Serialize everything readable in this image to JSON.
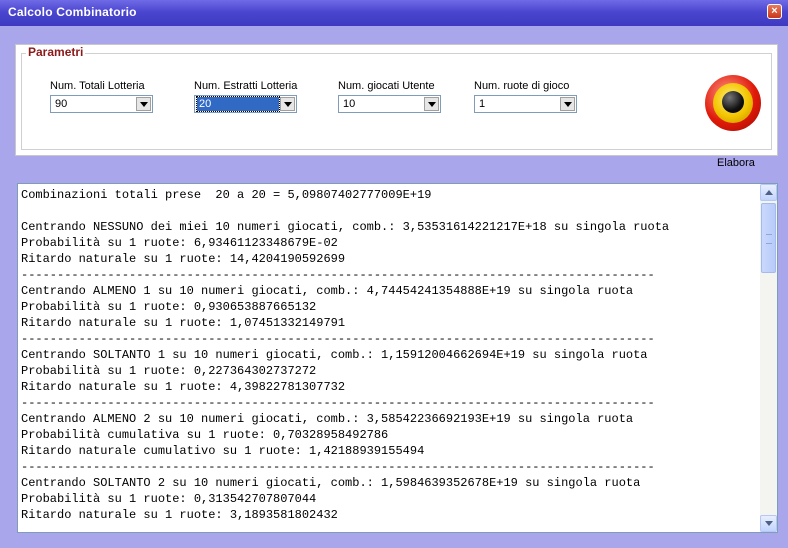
{
  "window": {
    "title": "Calcolo Combinatorio",
    "close_glyph": "×"
  },
  "params": {
    "legend": "Parametri",
    "fields": [
      {
        "label": "Num. Totali Lotteria",
        "value": "90"
      },
      {
        "label": "Num. Estratti Lotteria",
        "value": "20"
      },
      {
        "label": "Num. giocati Utente",
        "value": "10"
      },
      {
        "label": "Num. ruote di gioco",
        "value": "1"
      }
    ],
    "action": {
      "label": "Elabora",
      "icon": "record-button-icon"
    }
  },
  "output": {
    "lines": [
      "Combinazioni totali prese  20 a 20 = 5,09807402777009E+19",
      "",
      "Centrando NESSUNO dei miei 10 numeri giocati, comb.: 3,53531614221217E+18 su singola ruota",
      "Probabilità su 1 ruote: 6,93461123348679E-02",
      "Ritardo naturale su 1 ruote: 14,4204190592699",
      "----------------------------------------------------------------------------------------",
      "Centrando ALMENO 1 su 10 numeri giocati, comb.: 4,74454241354888E+19 su singola ruota",
      "Probabilità su 1 ruote: 0,930653887665132",
      "Ritardo naturale su 1 ruote: 1,07451332149791",
      "----------------------------------------------------------------------------------------",
      "Centrando SOLTANTO 1 su 10 numeri giocati, comb.: 1,15912004662694E+19 su singola ruota",
      "Probabilità su 1 ruote: 0,227364302737272",
      "Ritardo naturale su 1 ruote: 4,39822781307732",
      "----------------------------------------------------------------------------------------",
      "Centrando ALMENO 2 su 10 numeri giocati, comb.: 3,58542236692193E+19 su singola ruota",
      "Probabilità cumulativa su 1 ruote: 0,70328958492786",
      "Ritardo naturale cumulativo su 1 ruote: 1,42188939155494",
      "----------------------------------------------------------------------------------------",
      "Centrando SOLTANTO 2 su 10 numeri giocati, comb.: 1,5984639352678E+19 su singola ruota",
      "Probabilità su 1 ruote: 0,313542707807044",
      "Ritardo naturale su 1 ruote: 3,1893581802432"
    ]
  }
}
